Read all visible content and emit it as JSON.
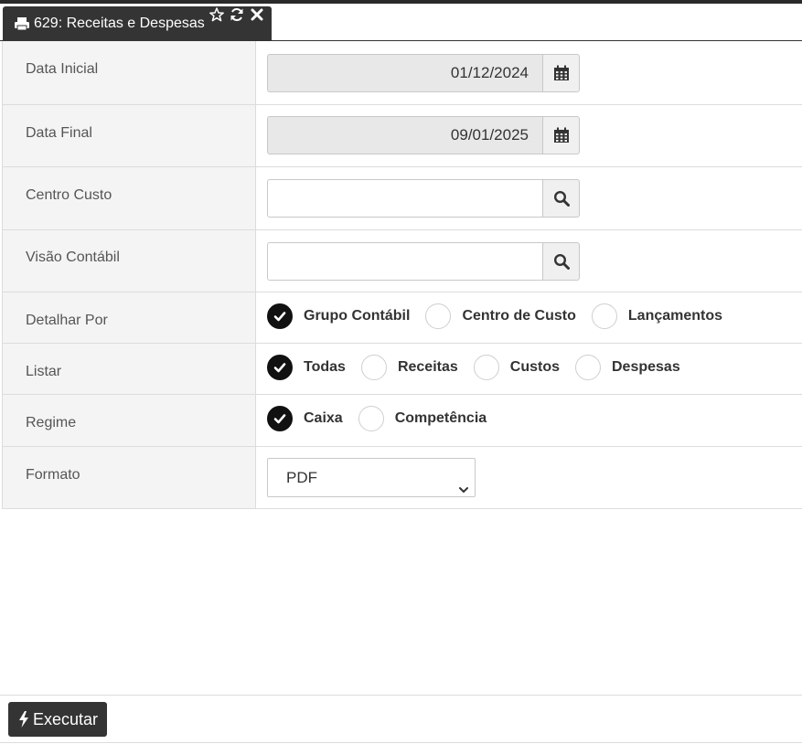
{
  "tab": {
    "title": "629: Receitas e Despesas",
    "icons": [
      "print-icon",
      "star-icon",
      "refresh-icon",
      "close-icon"
    ]
  },
  "form": {
    "data_inicial": {
      "label": "Data Inicial",
      "value": "01/12/2024",
      "icon": "calendar-icon"
    },
    "data_final": {
      "label": "Data Final",
      "value": "09/01/2025",
      "icon": "calendar-icon"
    },
    "centro_custo": {
      "label": "Centro Custo",
      "value": "",
      "icon": "search-icon"
    },
    "visao_contabil": {
      "label": "Visão Contábil",
      "value": "",
      "icon": "search-icon"
    },
    "detalhar_por": {
      "label": "Detalhar Por",
      "options": [
        "Grupo Contábil",
        "Centro de Custo",
        "Lançamentos"
      ],
      "selected": "Grupo Contábil"
    },
    "listar": {
      "label": "Listar",
      "options": [
        "Todas",
        "Receitas",
        "Custos",
        "Despesas"
      ],
      "selected": "Todas"
    },
    "regime": {
      "label": "Regime",
      "options": [
        "Caixa",
        "Competência"
      ],
      "selected": "Caixa"
    },
    "formato": {
      "label": "Formato",
      "selected": "PDF"
    }
  },
  "footer": {
    "run_label": "Executar",
    "run_icon": "bolt-icon"
  },
  "colors": {
    "tab_bg": "#343434",
    "label_bg": "#f4f4f4",
    "readonly_bg": "#e8e8e8",
    "radio_on": "#111111"
  }
}
